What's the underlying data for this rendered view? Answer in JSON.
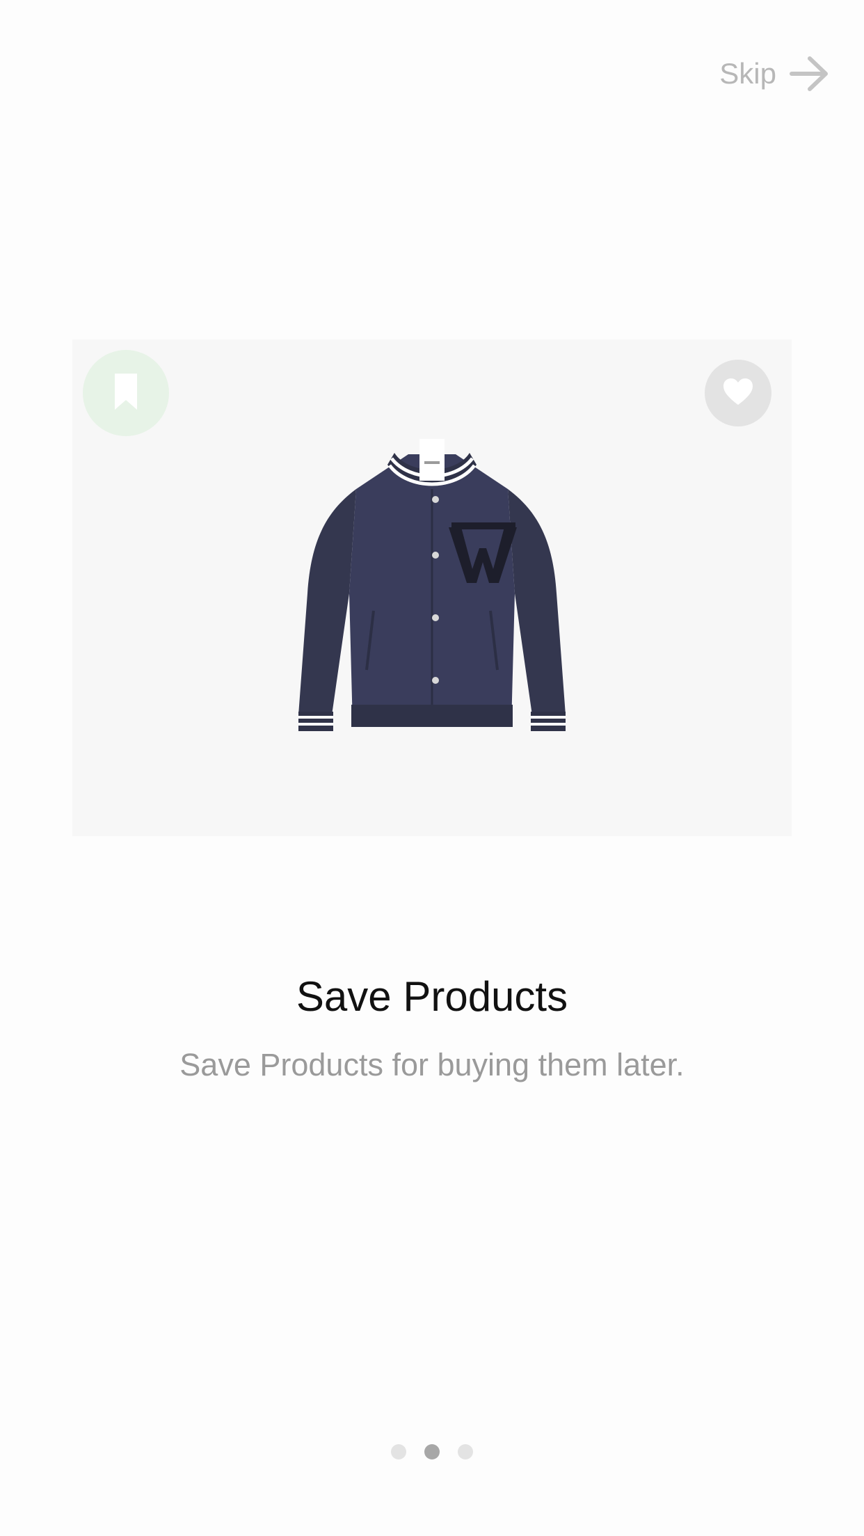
{
  "header": {
    "skip_label": "Skip",
    "skip_icon": "arrow-right-icon"
  },
  "card": {
    "bookmark_icon": "bookmark-icon",
    "favorite_icon": "heart-icon",
    "product_image": "navy-varsity-jacket"
  },
  "content": {
    "title": "Save Products",
    "subtitle": "Save Products for buying them later."
  },
  "pagination": {
    "total": 3,
    "active_index": 1
  },
  "colors": {
    "background": "#fdfdfd",
    "card_background": "#f7f7f7",
    "bookmark_badge": "#e7f3e7",
    "heart_badge": "#e3e3e3",
    "jacket_navy": "#3a3d5c",
    "dot_inactive": "#e3e3e3",
    "dot_active": "#a7a7a7"
  }
}
